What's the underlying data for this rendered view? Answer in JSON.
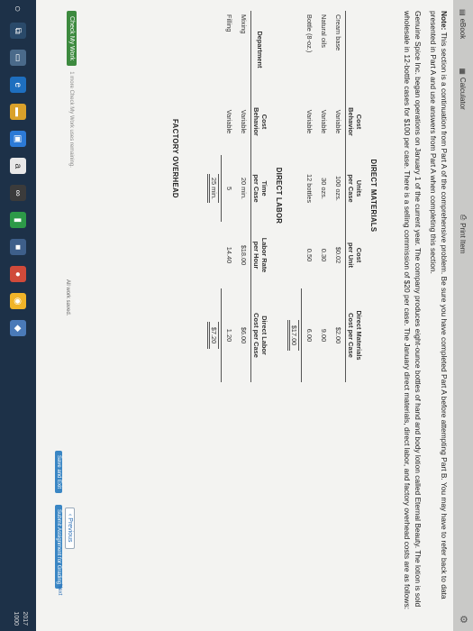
{
  "toolbar": {
    "ebook": "eBook",
    "calculator": "Calculator",
    "print": "Print Item"
  },
  "note": {
    "bold": "Note:",
    "text": " This section is a continuation from Part A of the comprehensive problem. Be sure you have completed Part A before attempting Part B. You may have to refer back to data presented in Part A and use answers from Part A when completing this section."
  },
  "intro": "Genuine Spice Inc. began operations on January 1 of the current year. The company produces eight-ounce bottles of hand and body lotion called Eternal Beauty. The lotion is sold wholesale in 12-bottle cases for $100 per case. There is a selling commission of $20 per case. The January direct materials, direct labor, and factory overhead costs are as follows:",
  "direct_materials": {
    "title": "DIRECT MATERIALS",
    "headers": [
      "",
      "Cost\nBehavior",
      "Units\nper Case",
      "Cost\nper Unit",
      "Direct Materials\nCost per Case"
    ],
    "rows": [
      [
        "Cream base",
        "Variable",
        "100 ozs.",
        "$0.02",
        "$2.00"
      ],
      [
        "Natural oils",
        "Variable",
        "30 ozs.",
        "0.30",
        "9.00"
      ],
      [
        "Bottle (8-oz.)",
        "Variable",
        "12 bottles",
        "0.50",
        "6.00"
      ]
    ],
    "total": "$17.00"
  },
  "direct_labor": {
    "title": "DIRECT LABOR",
    "headers": [
      "Department",
      "Cost\nBehavior",
      "Time\nper Case",
      "Labor Rate\nper Hour",
      "Direct Labor\nCost per Case"
    ],
    "rows": [
      [
        "Mixing",
        "Variable",
        "20 min.",
        "$18.00",
        "$6.00"
      ],
      [
        "Filling",
        "Variable",
        "5",
        "14.40",
        "1.20"
      ]
    ],
    "sum_time": "25 min.",
    "total": "$7.20"
  },
  "factory_overhead": {
    "title": "FACTORY OVERHEAD"
  },
  "footer": {
    "check": "Check My Work",
    "check_note": "1 more Check My Work uses remaining.",
    "saved": "All work saved.",
    "previous": "Previous",
    "save_exit": "Save and Exit",
    "submit": "Submit Assignment for Grading",
    "next": "Next"
  },
  "taskbar": {
    "clock": "2017\n1000"
  },
  "colors": {
    "taskbar": "#1d3148",
    "check_button": "#3d8a3f",
    "primary": "#3a86c4"
  }
}
